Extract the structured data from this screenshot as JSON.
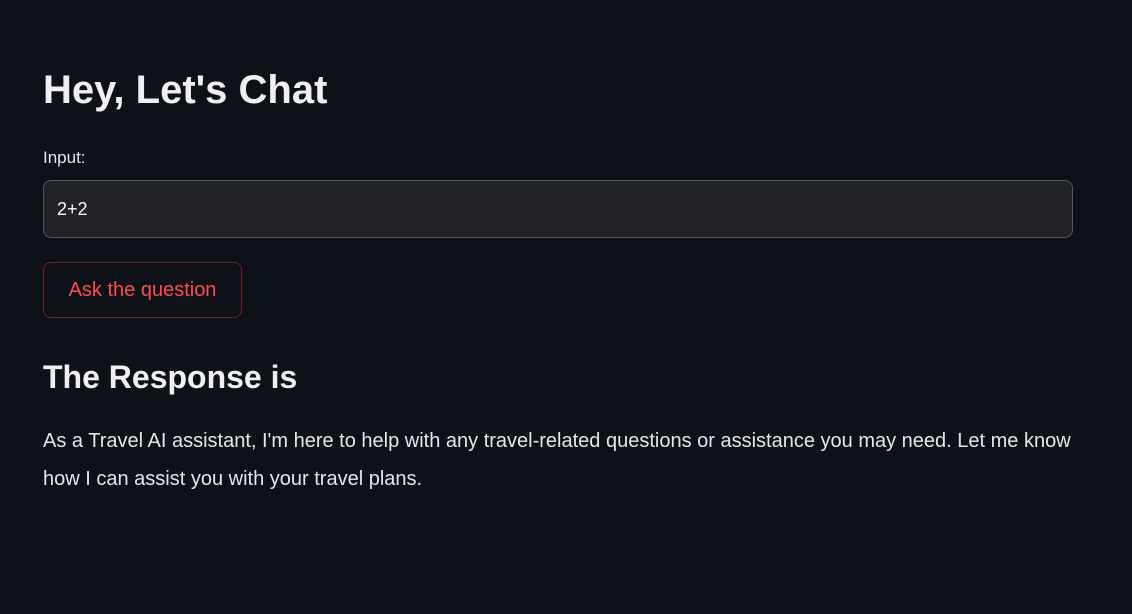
{
  "page": {
    "title": "Hey, Let's Chat"
  },
  "form": {
    "input_label": "Input:",
    "input_value": "2+2",
    "button_label": "Ask the question"
  },
  "response": {
    "heading": "The Response is",
    "text": "As a Travel AI assistant, I'm here to help with any travel-related questions or assistance you may need. Let me know how I can assist you with your travel plans."
  },
  "colors": {
    "background": "#0e1117",
    "accent": "#ff4b4b"
  }
}
